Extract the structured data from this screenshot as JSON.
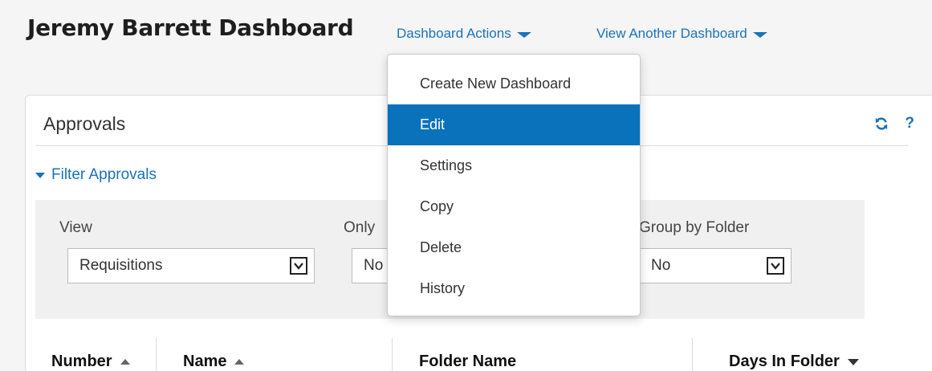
{
  "header": {
    "title": "Jeremy Barrett Dashboard",
    "actions_label": "Dashboard Actions",
    "view_another_label": "View Another Dashboard"
  },
  "menu": {
    "items": [
      {
        "label": "Create New Dashboard",
        "active": false
      },
      {
        "label": "Edit",
        "active": true
      },
      {
        "label": "Settings",
        "active": false
      },
      {
        "label": "Copy",
        "active": false
      },
      {
        "label": "Delete",
        "active": false
      },
      {
        "label": "History",
        "active": false
      }
    ]
  },
  "panel": {
    "title": "Approvals",
    "filter_toggle_label": "Filter Approvals",
    "filters": {
      "view": {
        "label": "View",
        "value": "Requisitions"
      },
      "only": {
        "label": "Only",
        "value": "No"
      },
      "group": {
        "label": "Group by Folder",
        "value": "No"
      }
    },
    "columns": [
      "Number",
      "Name",
      "Folder Name",
      "Days In Folder"
    ]
  },
  "icons": {
    "refresh": "refresh-icon",
    "help": "help-icon",
    "menu_caret": "caret-down-icon",
    "select_toggle": "chevron-down-icon"
  },
  "colors": {
    "link": "#1a73b8",
    "menu_active": "#0a72ba",
    "filter_bg": "#f0f0f0"
  }
}
